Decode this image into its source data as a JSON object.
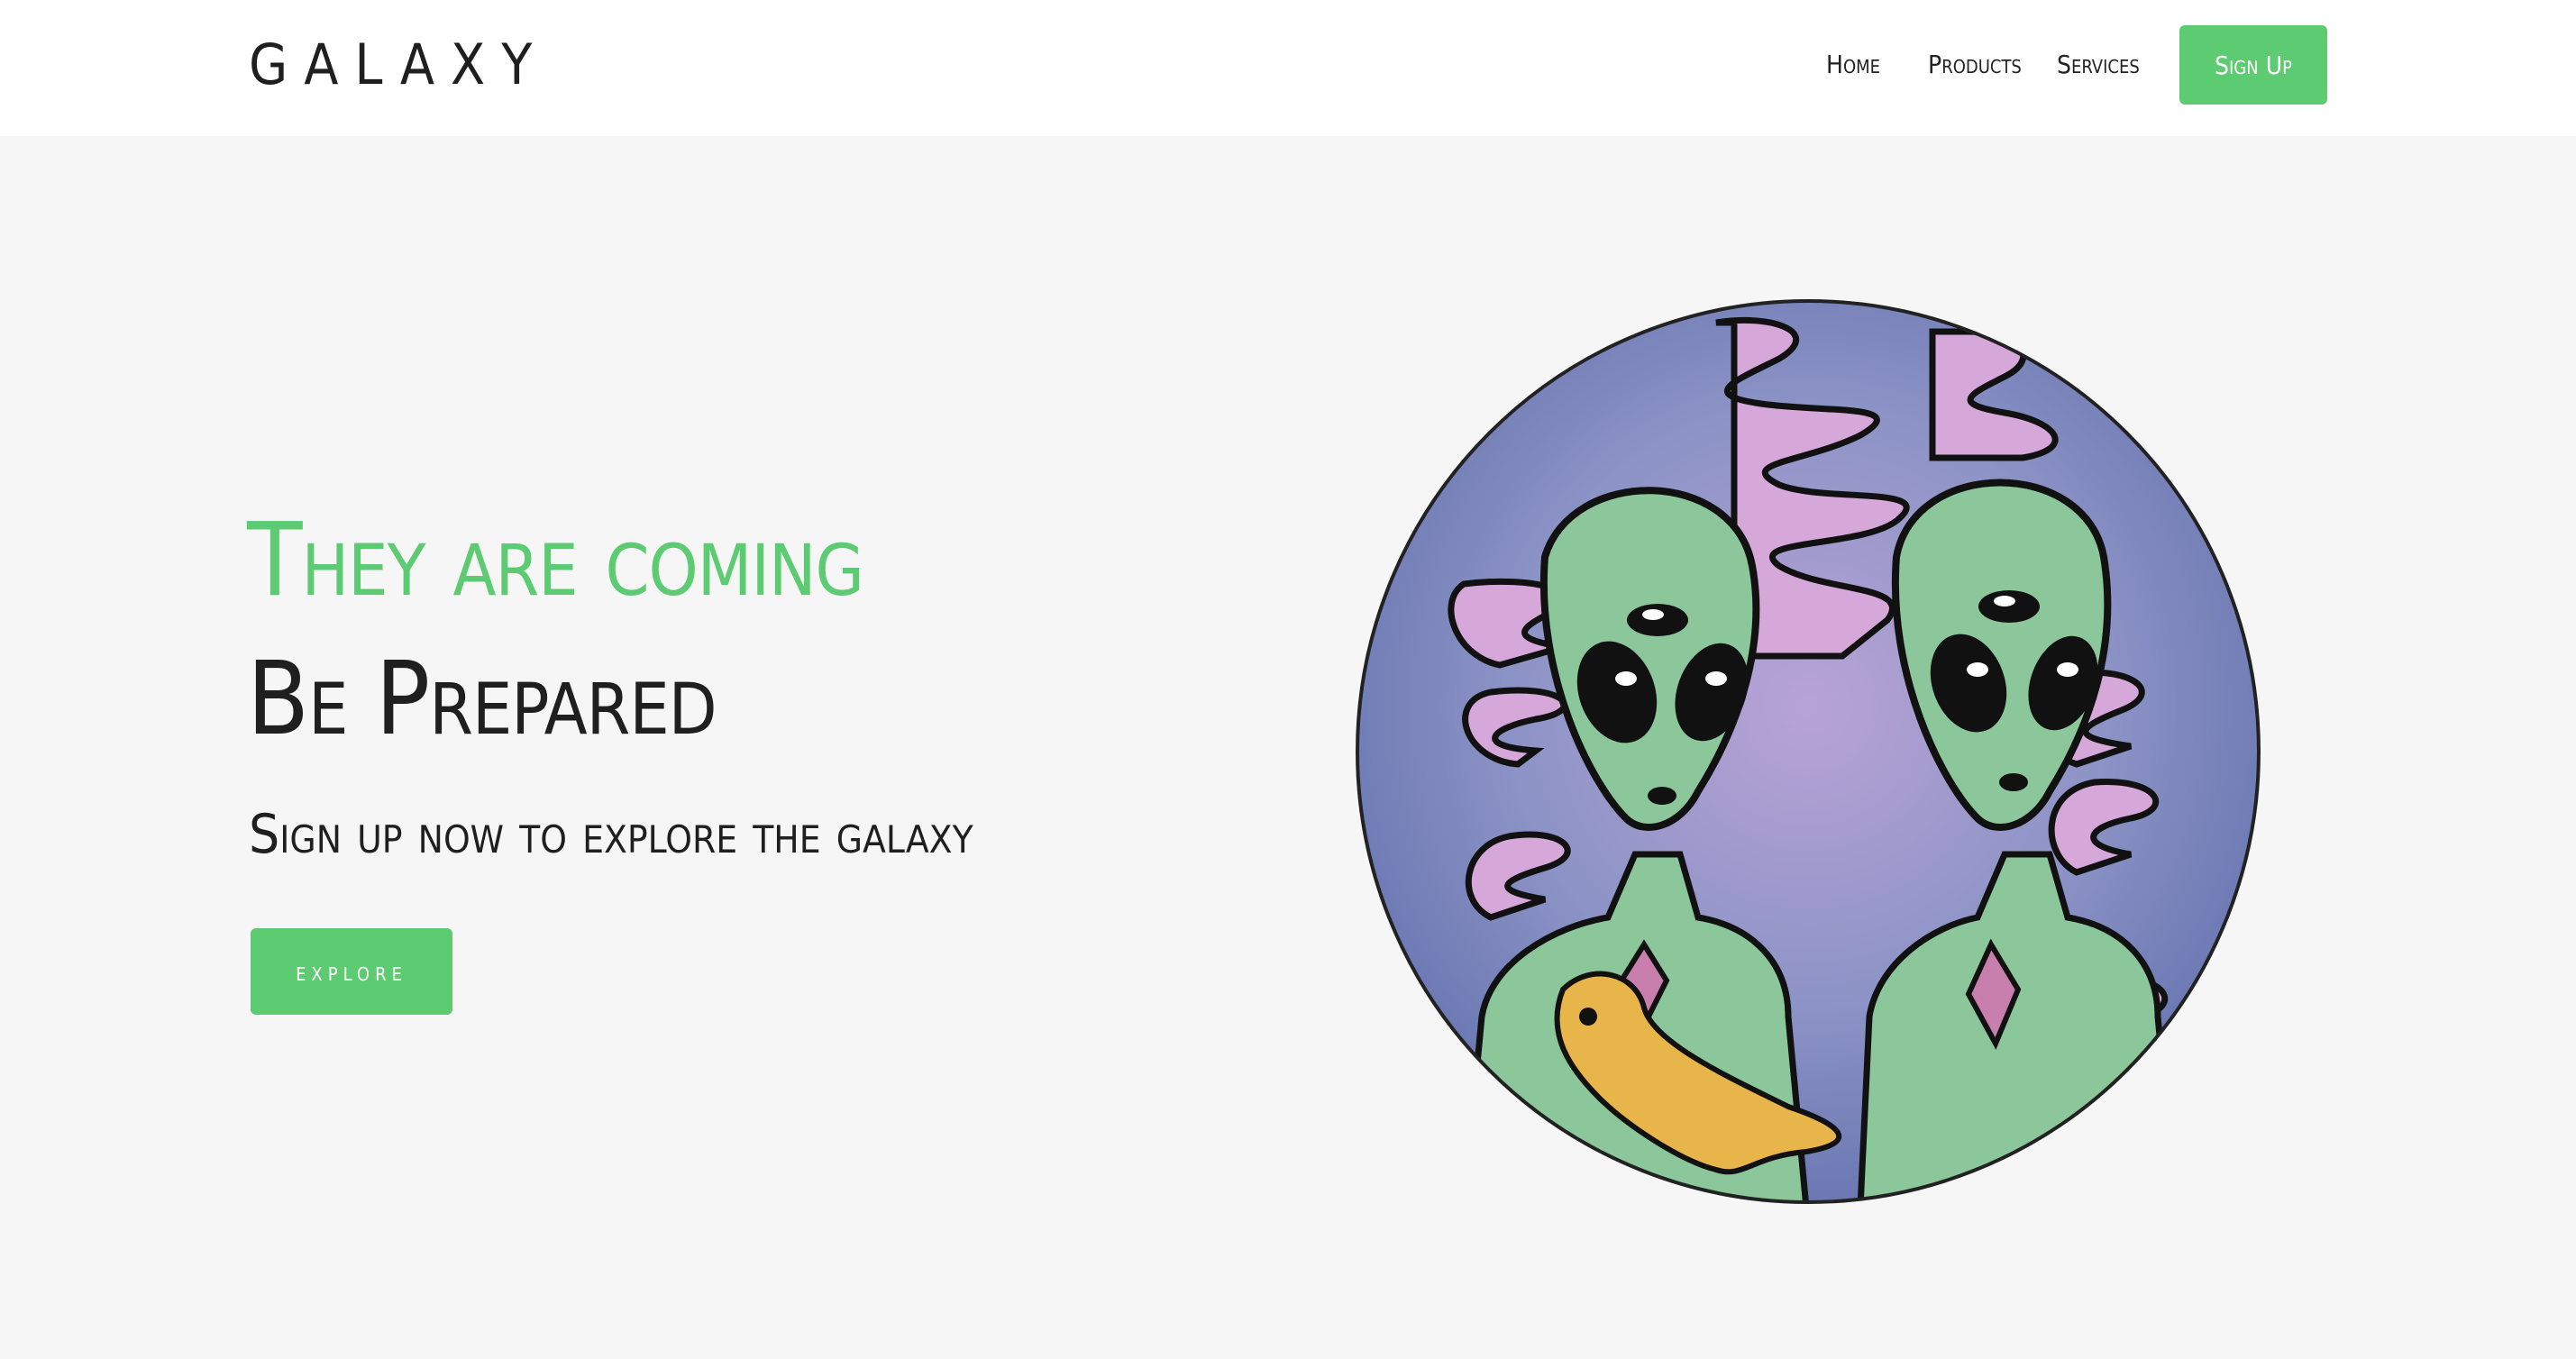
{
  "header": {
    "logo": "GALAXY",
    "nav": [
      "Home",
      "Products",
      "Services"
    ],
    "signup_label": "Sign Up"
  },
  "hero": {
    "title_line1": "They are coming",
    "title_line2": "Be Prepared",
    "subtitle": "Sign up now to explore the galaxy",
    "button_label": "explore"
  },
  "colors": {
    "accent": "#5ccb71",
    "page_background": "#f6f6f6",
    "header_background": "#ffffff",
    "text": "#1f1f1f"
  },
  "illustration": {
    "icon": "aliens-illustration"
  }
}
